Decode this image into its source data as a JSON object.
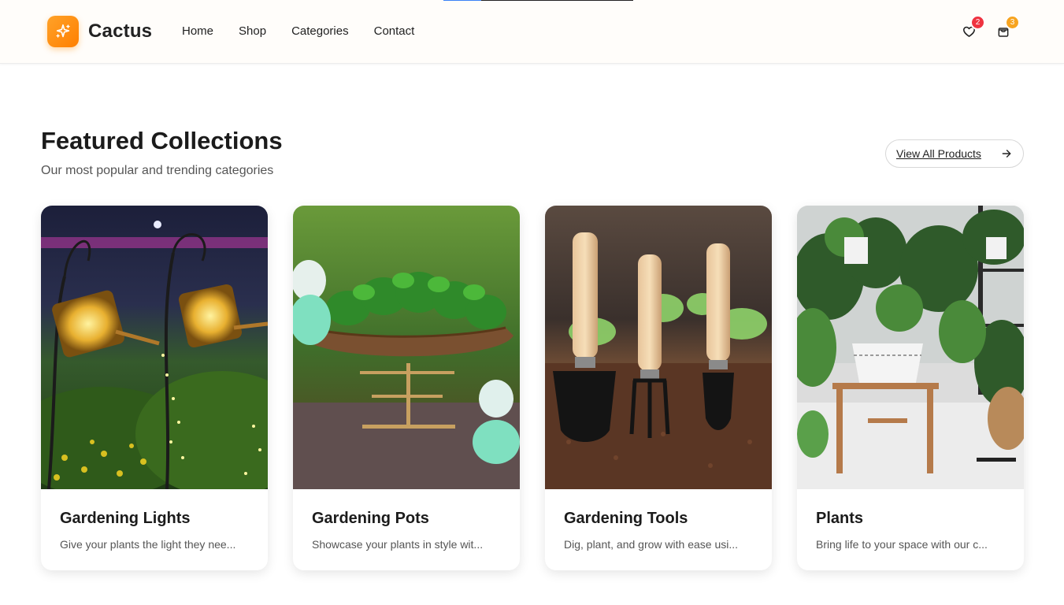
{
  "brand": {
    "name": "Cactus",
    "logo_icon": "sparkle-icon",
    "accent": "#ff8a00"
  },
  "nav": {
    "items": [
      "Home",
      "Shop",
      "Categories",
      "Contact"
    ]
  },
  "header_icons": {
    "wishlist": {
      "icon": "heart-icon",
      "count": "2",
      "badge_color": "#ef3340"
    },
    "cart": {
      "icon": "shopping-bag-icon",
      "count": "3",
      "badge_color": "#f7a420"
    }
  },
  "section": {
    "title": "Featured Collections",
    "subtitle": "Our most popular and trending categories",
    "view_all_label": "View All Products",
    "view_all_icon": "arrow-right-icon"
  },
  "cards": [
    {
      "title": "Gardening Lights",
      "description": "Give your plants the light they nee..."
    },
    {
      "title": "Gardening Pots",
      "description": "Showcase your plants in style wit..."
    },
    {
      "title": "Gardening Tools",
      "description": "Dig, plant, and grow with ease usi..."
    },
    {
      "title": "Plants",
      "description": "Bring life to your space with our c..."
    }
  ]
}
